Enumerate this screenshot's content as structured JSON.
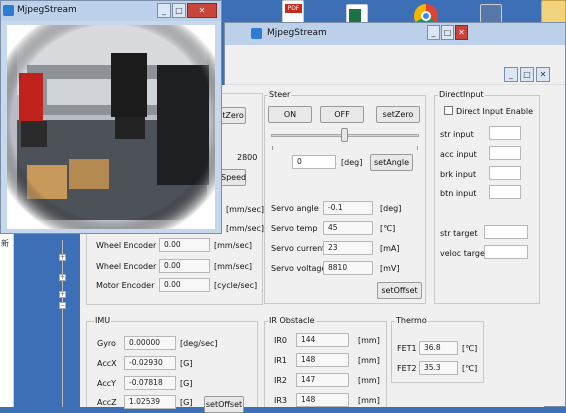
{
  "colors": {
    "desktop": "#3c6fb5",
    "titlebar": "#bcd0ea",
    "close": "#c8453c"
  },
  "desktop_icons": [
    "pdf-file-icon",
    "excel-file-icon",
    "chrome-icon",
    "folder-icon",
    "app-icon"
  ],
  "pdf_badge": "PDF",
  "sidebar_char": "新",
  "back_window": {
    "title": "MjpegStream"
  },
  "front_window": {
    "title": "MjpegStream"
  },
  "steer": {
    "title": "Steer",
    "on": "ON",
    "off": "OFF",
    "set_zero": "setZero",
    "angle_value": "0",
    "angle_unit": "[deg]",
    "set_angle": "setAngle"
  },
  "partial": {
    "set_zero": "tZero",
    "speed": "Speed",
    "value": "2800"
  },
  "servo": [
    {
      "label": "Servo angle",
      "value": "-0.1",
      "unit": "[deg]"
    },
    {
      "label": "Servo temp",
      "value": "45",
      "unit": "[℃]"
    },
    {
      "label": "Servo current",
      "value": "23",
      "unit": "[mA]"
    },
    {
      "label": "Servo voltage",
      "value": "8810",
      "unit": "[mV]"
    }
  ],
  "set_offset": "setOffset",
  "encoder_rows": [
    {
      "label": "",
      "value": "",
      "unit": "[mm/sec]"
    },
    {
      "label": "",
      "value": "",
      "unit": "[mm/sec]"
    },
    {
      "label": "Wheel Encoder RL",
      "value": "0.00",
      "unit": "[mm/sec]"
    },
    {
      "label": "Wheel Encoder RR",
      "value": "0.00",
      "unit": "[mm/sec]"
    },
    {
      "label": "Motor Encoder",
      "value": "0.00",
      "unit": "[cycle/sec]"
    }
  ],
  "direct": {
    "title": "DirectInput",
    "checkbox": "Direct Input Enable",
    "inputs": [
      {
        "label": "str input"
      },
      {
        "label": "acc input"
      },
      {
        "label": "brk input"
      },
      {
        "label": "btn input"
      }
    ],
    "targets": [
      {
        "label": "str target"
      },
      {
        "label": "veloc target"
      }
    ]
  },
  "imu": {
    "title": "IMU",
    "rows": [
      {
        "label": "Gyro",
        "value": "0.00000",
        "unit": "[deg/sec]"
      },
      {
        "label": "AccX",
        "value": "-0.02930",
        "unit": "[G]"
      },
      {
        "label": "AccY",
        "value": "-0.07818",
        "unit": "[G]"
      },
      {
        "label": "AccZ",
        "value": "1.02539",
        "unit": "[G]"
      }
    ],
    "set_offset": "setOffset"
  },
  "ir": {
    "title": "IR Obstacle",
    "rows": [
      {
        "label": "IR0",
        "value": "144",
        "unit": "[mm]"
      },
      {
        "label": "IR1",
        "value": "148",
        "unit": "[mm]"
      },
      {
        "label": "IR2",
        "value": "147",
        "unit": "[mm]"
      },
      {
        "label": "IR3",
        "value": "148",
        "unit": "[mm]"
      }
    ]
  },
  "thermo": {
    "title": "Thermo",
    "rows": [
      {
        "label": "FET1",
        "value": "36.8",
        "unit": "[℃]"
      },
      {
        "label": "FET2",
        "value": "35.3",
        "unit": "[℃]"
      }
    ]
  },
  "tree_marks": [
    "+",
    "+",
    "+",
    "+",
    "−"
  ]
}
